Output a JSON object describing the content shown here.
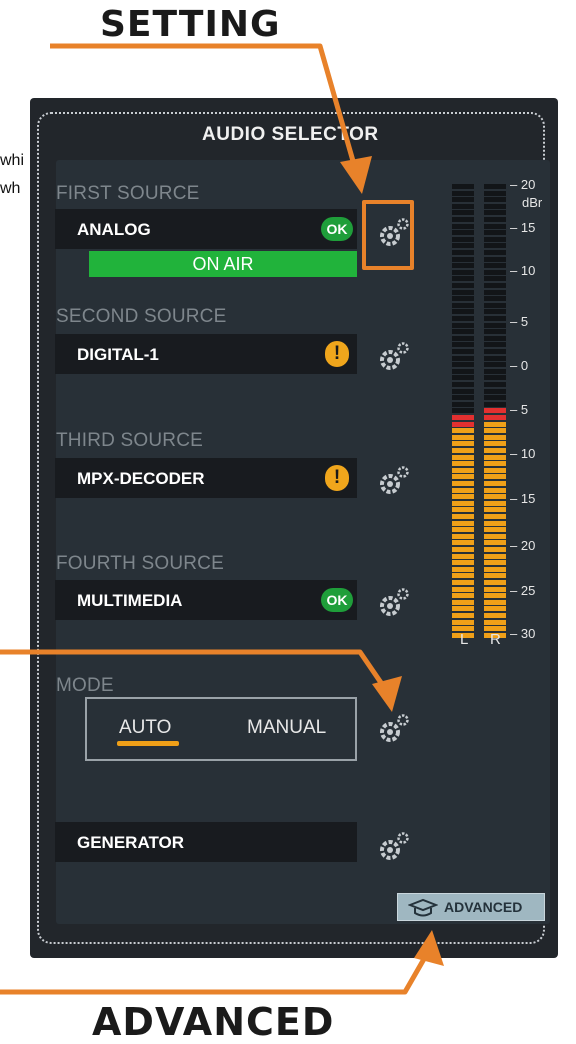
{
  "callouts": {
    "setting": "SETTING",
    "advanced": "ADVANCED"
  },
  "clipped_text": [
    "whi",
    "wh"
  ],
  "panel": {
    "title": "AUDIO SELECTOR",
    "sources": [
      {
        "label": "FIRST SOURCE",
        "name": "ANALOG",
        "status": "OK",
        "on_air": "ON AIR"
      },
      {
        "label": "SECOND SOURCE",
        "name": "DIGITAL-1",
        "status": "!"
      },
      {
        "label": "THIRD SOURCE",
        "name": "MPX-DECODER",
        "status": "!"
      },
      {
        "label": "FOURTH SOURCE",
        "name": "MULTIMEDIA",
        "status": "OK"
      }
    ],
    "mode": {
      "label": "MODE",
      "options": [
        "AUTO",
        "MANUAL"
      ],
      "selected": "AUTO"
    },
    "generator": {
      "name": "GENERATOR"
    },
    "advanced_button": "ADVANCED"
  },
  "meter": {
    "scale": [
      "20",
      "dBr",
      "15",
      "10",
      "5",
      "0",
      "5",
      "10",
      "15",
      "20",
      "25",
      "30"
    ],
    "channels": [
      "L",
      "R"
    ],
    "level_L_dB": -6,
    "level_R_dB": -5
  },
  "colors": {
    "panel_bg": "#22262b",
    "content_bg": "#283037",
    "ok_green": "#1f9e3a",
    "on_air_green": "#21b33b",
    "warning_orange": "#f0a61c",
    "meter_amber": "#f0a018",
    "meter_peak_red": "#e33030",
    "annotation_orange": "#e8822a"
  },
  "icons": [
    "gear-icon",
    "ok-icon",
    "warning-icon",
    "graduation-cap-icon"
  ]
}
